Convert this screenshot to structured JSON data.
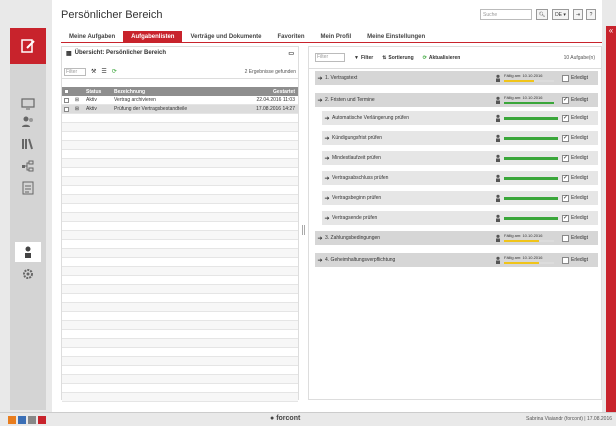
{
  "header": {
    "title": "Persönlicher Bereich",
    "search_placeholder": "Suche",
    "lang": "DE"
  },
  "tabs": [
    {
      "label": "Meine Aufgaben"
    },
    {
      "label": "Aufgabenlisten"
    },
    {
      "label": "Verträge und Dokumente"
    },
    {
      "label": "Favoriten"
    },
    {
      "label": "Mein Profil"
    },
    {
      "label": "Meine Einstellungen"
    }
  ],
  "left_panel": {
    "title": "Übersicht: Persönlicher Bereich",
    "filter_placeholder": "Filter",
    "result_count": "2 Ergebnisse gefunden",
    "columns": [
      "Status",
      "Bezeichnung",
      "Gestartet"
    ],
    "rows": [
      {
        "status": "Aktiv",
        "name": "Vertrag archivieren",
        "started": "22.04.2016 11:03"
      },
      {
        "status": "Aktiv",
        "name": "Prüfung der Vertragsbestandteile",
        "started": "17.08.2016 14:27"
      }
    ]
  },
  "right_panel": {
    "filter_placeholder": "Filter",
    "filter_label": "Filter",
    "sort_label": "Sortierung",
    "refresh_label": "Aktualisieren",
    "count": "10 Aufgabe(n)",
    "done_label": "Erledigt",
    "due_prefix": "Fällig am:",
    "tasks": [
      {
        "title": "1. Vertragstext",
        "due": "10.10.2016",
        "progress": 0.6,
        "done": false,
        "level": "top"
      },
      {
        "title": "2. Fristen und Termine",
        "due": "10.10.2016",
        "progress": 1.0,
        "done": true,
        "level": "top"
      },
      {
        "title": "Automatische Verlängerung prüfen",
        "progress": 1.0,
        "done": true,
        "level": "sub"
      },
      {
        "title": "Kündigungsfrist prüfen",
        "progress": 1.0,
        "done": true,
        "level": "sub"
      },
      {
        "title": "Mindestlaufzeit prüfen",
        "progress": 1.0,
        "done": true,
        "level": "sub"
      },
      {
        "title": "Vertragsabschluss prüfen",
        "progress": 1.0,
        "done": true,
        "level": "sub"
      },
      {
        "title": "Vertragsbeginn prüfen",
        "progress": 1.0,
        "done": true,
        "level": "sub"
      },
      {
        "title": "Vertragsende prüfen",
        "progress": 1.0,
        "done": true,
        "level": "sub"
      },
      {
        "title": "3. Zahlungsbedingungen",
        "due": "10.10.2016",
        "progress": 0.7,
        "done": false,
        "level": "top"
      },
      {
        "title": "4. Geheimhaltungsverpflichtung",
        "due": "10.10.2016",
        "progress": 0.7,
        "done": false,
        "level": "top"
      }
    ]
  },
  "footer": {
    "brand": "forcont",
    "user": "Sabrina Viaiandr (forcont) | 17.08.2016"
  },
  "colors": {
    "accent": "#c8232c",
    "progress": "#3aa63a",
    "due_bar": "#f0c419"
  }
}
